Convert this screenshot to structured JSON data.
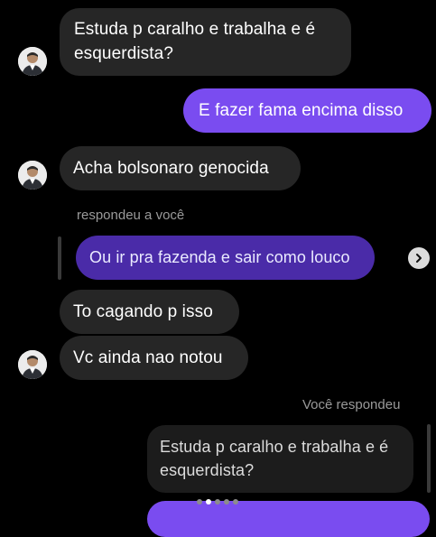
{
  "messages": {
    "m1_line1": "Estuda p caralho e trabalha e é",
    "m1_line2": "esquerdista?",
    "m2": "E fazer fama encima disso",
    "m3": "Acha bolsonaro genocida",
    "reply_label_in": "respondeu a você",
    "quoted_in": "Ou ir pra fazenda e sair como louco",
    "m4": "To cagando p isso",
    "m5": "Vc ainda nao notou",
    "reply_label_out": "Você respondeu",
    "quoted_out_line1": "Estuda p caralho e trabalha e é",
    "quoted_out_line2": "esquerdista?"
  },
  "colors": {
    "background": "#000000",
    "incoming_bubble": "#262626",
    "outgoing_bubble": "#7a4cf0",
    "quoted_incoming": "#4a2ba8",
    "quoted_outgoing": "#1c1c1c",
    "meta_text": "#9a9a9a"
  },
  "icons": {
    "share": "chevron-right-icon",
    "avatar": "profile-avatar"
  },
  "pagination": {
    "total_dots": 5,
    "active_dot": 1
  }
}
